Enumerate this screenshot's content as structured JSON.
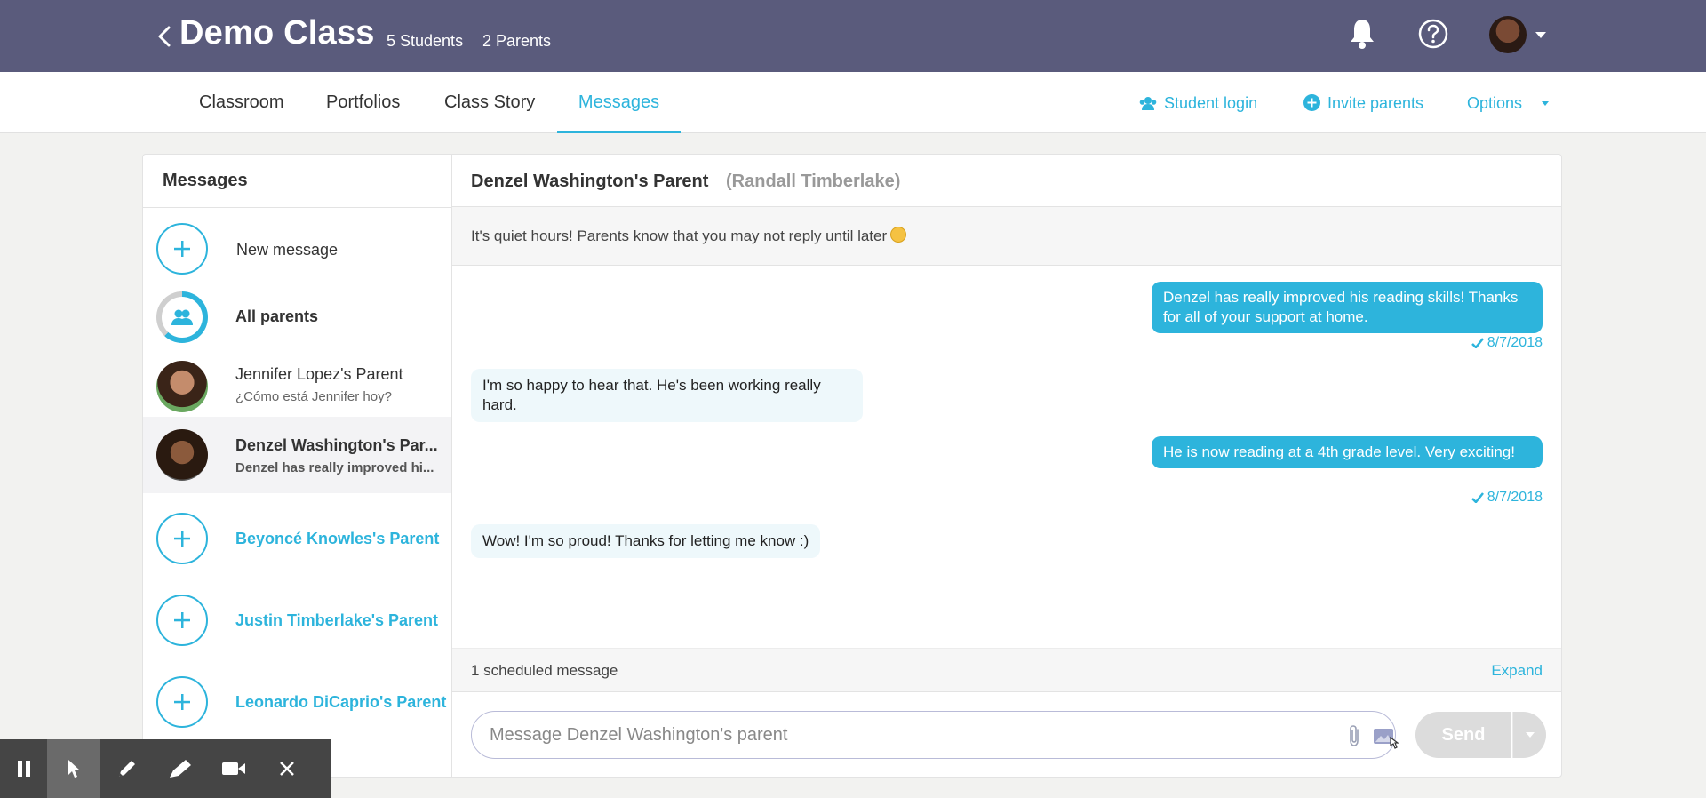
{
  "header": {
    "title": "Demo Class",
    "students": "5 Students",
    "parents": "2 Parents",
    "icons": [
      "back-chevron-icon",
      "bell-icon",
      "help-icon",
      "avatar",
      "caret-down-icon"
    ]
  },
  "nav": {
    "tabs": [
      {
        "label": "Classroom"
      },
      {
        "label": "Portfolios"
      },
      {
        "label": "Class Story"
      },
      {
        "label": "Messages",
        "active": true
      }
    ],
    "student_login": "Student login",
    "invite_parents": "Invite parents",
    "options": "Options"
  },
  "sidebar": {
    "title": "Messages",
    "new_message": "New message",
    "all_parents": "All parents",
    "items": [
      {
        "name": "Jennifer Lopez's Parent",
        "preview": "¿Cómo está Jennifer hoy?"
      },
      {
        "name": "Denzel Washington's Par...",
        "preview": "Denzel has really improved hi...",
        "selected": true
      },
      {
        "name": "Beyoncé Knowles's Parent"
      },
      {
        "name": "Justin Timberlake's Parent"
      },
      {
        "name": "Leonardo DiCaprio's Parent"
      }
    ]
  },
  "conversation": {
    "title": "Denzel Washington's Parent",
    "subtitle": "(Randall Timberlake)",
    "quiet_hours": "It's quiet hours! Parents know that you may not reply until later",
    "messages": [
      {
        "direction": "out",
        "text": "Denzel has really improved his reading skills! Thanks for all of your support at home.",
        "date": "8/7/2018"
      },
      {
        "direction": "in",
        "text": "I'm so happy to hear that. He's been working really hard."
      },
      {
        "direction": "out",
        "text": "He is now reading at a 4th grade level. Very exciting!",
        "date": "8/7/2018"
      },
      {
        "direction": "in",
        "text": "Wow! I'm so proud! Thanks for letting me know :)"
      }
    ],
    "scheduled": "1 scheduled message",
    "expand": "Expand",
    "input_placeholder": "Message Denzel Washington's parent",
    "send": "Send"
  },
  "colors": {
    "header_bg": "#5a5b7c",
    "accent": "#2db4dc"
  }
}
